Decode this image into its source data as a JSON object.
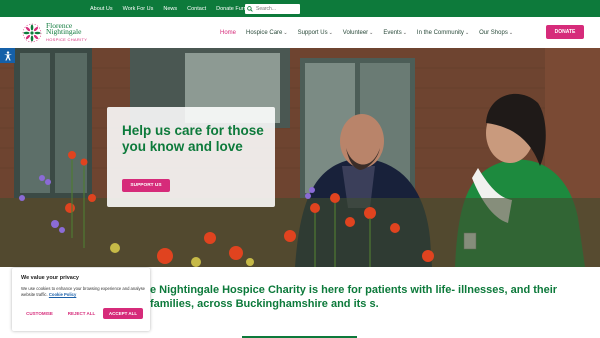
{
  "topbar": {
    "links": [
      "About Us",
      "Work For Us",
      "News",
      "Contact",
      "Donate Furniture"
    ],
    "search_placeholder": "Search..."
  },
  "logo": {
    "line1": "Florence",
    "line2": "Nightingale",
    "line3": "HOSPICE CHARITY"
  },
  "nav": {
    "items": [
      {
        "label": "Home",
        "active": true,
        "dropdown": false
      },
      {
        "label": "Hospice Care",
        "dropdown": true
      },
      {
        "label": "Support Us",
        "dropdown": true
      },
      {
        "label": "Volunteer",
        "dropdown": true
      },
      {
        "label": "Events",
        "dropdown": true
      },
      {
        "label": "In the Community",
        "dropdown": true
      },
      {
        "label": "Our Shops",
        "dropdown": true
      }
    ],
    "donate_label": "DONATE"
  },
  "hero": {
    "headline": "Help us care for those you know and love",
    "cta_label": "SUPPORT US"
  },
  "intro": {
    "text": "e Nightingale Hospice Charity is here for patients with life- illnesses, and their families, across Buckinghamshire and its s."
  },
  "cookie": {
    "title": "We value your privacy",
    "description": "We use cookies to enhance your browsing experience and analyse website traffic.",
    "policy_link": "Cookie Policy",
    "customise_label": "CUSTOMISE",
    "reject_label": "REJECT ALL",
    "accept_label": "ACCEPT ALL"
  },
  "colors": {
    "brand_green": "#0d7a3b",
    "brand_pink": "#d62b7a",
    "accessibility_blue": "#1560a8"
  }
}
